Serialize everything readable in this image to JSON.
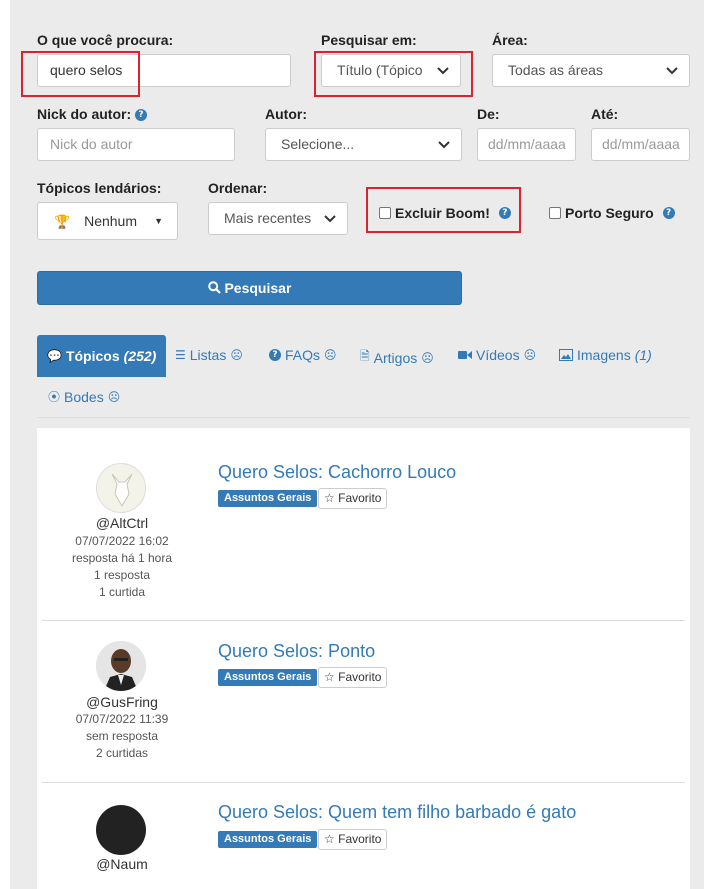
{
  "filters": {
    "query_label": "O que você procura:",
    "query_value": "quero selos",
    "search_in_label": "Pesquisar em:",
    "search_in_value": "Título (Tópico",
    "area_label": "Área:",
    "area_value": "Todas as áreas",
    "nick_label": "Nick do autor:",
    "nick_placeholder": "Nick do autor",
    "author_label": "Autor:",
    "author_value": "Selecione...",
    "from_label": "De:",
    "from_placeholder": "dd/mm/aaaa",
    "to_label": "Até:",
    "to_placeholder": "dd/mm/aaaa",
    "legendary_label": "Tópicos lendários:",
    "legendary_value": "Nenhum",
    "order_label": "Ordenar:",
    "order_value": "Mais recentes",
    "exclude_boom_label": "Excluir Boom!",
    "porto_seguro_label": "Porto Seguro",
    "search_button": "Pesquisar"
  },
  "tabs": [
    {
      "label": "Tópicos",
      "count": "(252)"
    },
    {
      "label": "Listas",
      "count": "☹"
    },
    {
      "label": "FAQs",
      "count": "☹"
    },
    {
      "label": "Artigos",
      "count": "☹"
    },
    {
      "label": "Vídeos",
      "count": "☹"
    },
    {
      "label": "Imagens",
      "count": "(1)"
    },
    {
      "label": "Bodes",
      "count": "☹"
    }
  ],
  "results": [
    {
      "title": "Quero Selos: Cachorro Louco",
      "tag": "Assuntos Gerais",
      "favorite": "Favorito",
      "author": "@AltCtrl",
      "date": "07/07/2022 16:02",
      "reply_info": "resposta há 1 hora",
      "replies": "1 resposta",
      "likes": "1 curtida"
    },
    {
      "title": "Quero Selos: Ponto",
      "tag": "Assuntos Gerais",
      "favorite": "Favorito",
      "author": "@GusFring",
      "date": "07/07/2022 11:39",
      "reply_info": "sem resposta",
      "likes": "2 curtidas"
    },
    {
      "title": "Quero Selos: Quem tem filho barbado é gato",
      "tag": "Assuntos Gerais",
      "favorite": "Favorito",
      "author": "@Naum"
    }
  ],
  "colors": {
    "accent": "#337ab7",
    "highlight_box": "#d9232d",
    "background": "#ebebeb"
  }
}
